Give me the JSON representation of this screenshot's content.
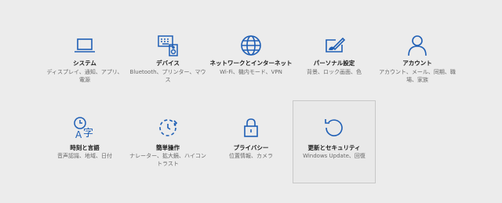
{
  "accent_color": "#1f5fb5",
  "tiles": [
    {
      "title": "システム",
      "desc": "ディスプレイ、通知、アプリ、電源",
      "icon": "laptop-icon"
    },
    {
      "title": "デバイス",
      "desc": "Bluetooth、プリンター、マウス",
      "icon": "devices-icon"
    },
    {
      "title": "ネットワークとインターネット",
      "desc": "Wi-Fi、機内モード、VPN",
      "icon": "globe-icon"
    },
    {
      "title": "パーソナル設定",
      "desc": "背景、ロック画面、色",
      "icon": "personalization-icon"
    },
    {
      "title": "アカウント",
      "desc": "アカウント、メール、同期、職場、家族",
      "icon": "account-icon"
    },
    {
      "title": "時刻と言語",
      "desc": "音声認識、地域、日付",
      "icon": "time-language-icon"
    },
    {
      "title": "簡単操作",
      "desc": "ナレーター、拡大鏡、ハイコントラスト",
      "icon": "ease-of-access-icon"
    },
    {
      "title": "プライバシー",
      "desc": "位置情報、カメラ",
      "icon": "lock-icon"
    },
    {
      "title": "更新とセキュリティ",
      "desc": "Windows Update、回復",
      "icon": "update-icon"
    }
  ]
}
